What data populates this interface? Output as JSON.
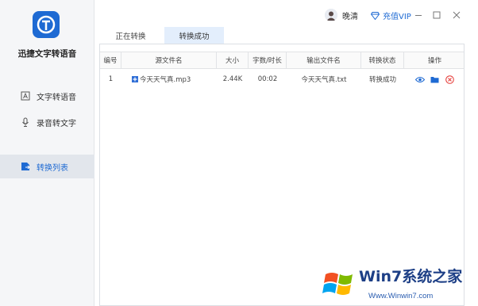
{
  "app": {
    "name": "迅捷文字转语音"
  },
  "sidebar": {
    "items": [
      {
        "label": "文字转语音",
        "icon": "text-document-icon",
        "active": false
      },
      {
        "label": "录音转文字",
        "icon": "microphone-icon",
        "active": false
      },
      {
        "label": "转换列表",
        "icon": "convert-list-icon",
        "active": true
      }
    ]
  },
  "header": {
    "user_name": "晚清",
    "vip_label": "充值VIP",
    "window_controls": [
      "minimize",
      "maximize",
      "close"
    ]
  },
  "tabs": [
    {
      "label": "正在转换",
      "active": false
    },
    {
      "label": "转换成功",
      "active": true
    }
  ],
  "table": {
    "columns": [
      "编号",
      "源文件名",
      "大小",
      "字数/时长",
      "输出文件名",
      "转换状态",
      "操作"
    ],
    "rows": [
      {
        "index": "1",
        "source": "今天天气真.mp3",
        "size": "2.44K",
        "duration": "00:02",
        "output": "今天天气真.txt",
        "status": "转换成功",
        "actions": [
          "view-icon",
          "open-folder-icon",
          "delete-icon"
        ]
      }
    ]
  },
  "watermark": {
    "brand": "Win7系统之家",
    "url": "Www.Winwin7.com"
  },
  "colors": {
    "accent": "#1e6ad3",
    "sidebar_bg": "#f5f6f8",
    "active_tab": "#e3eefc",
    "delete": "#e53935"
  }
}
